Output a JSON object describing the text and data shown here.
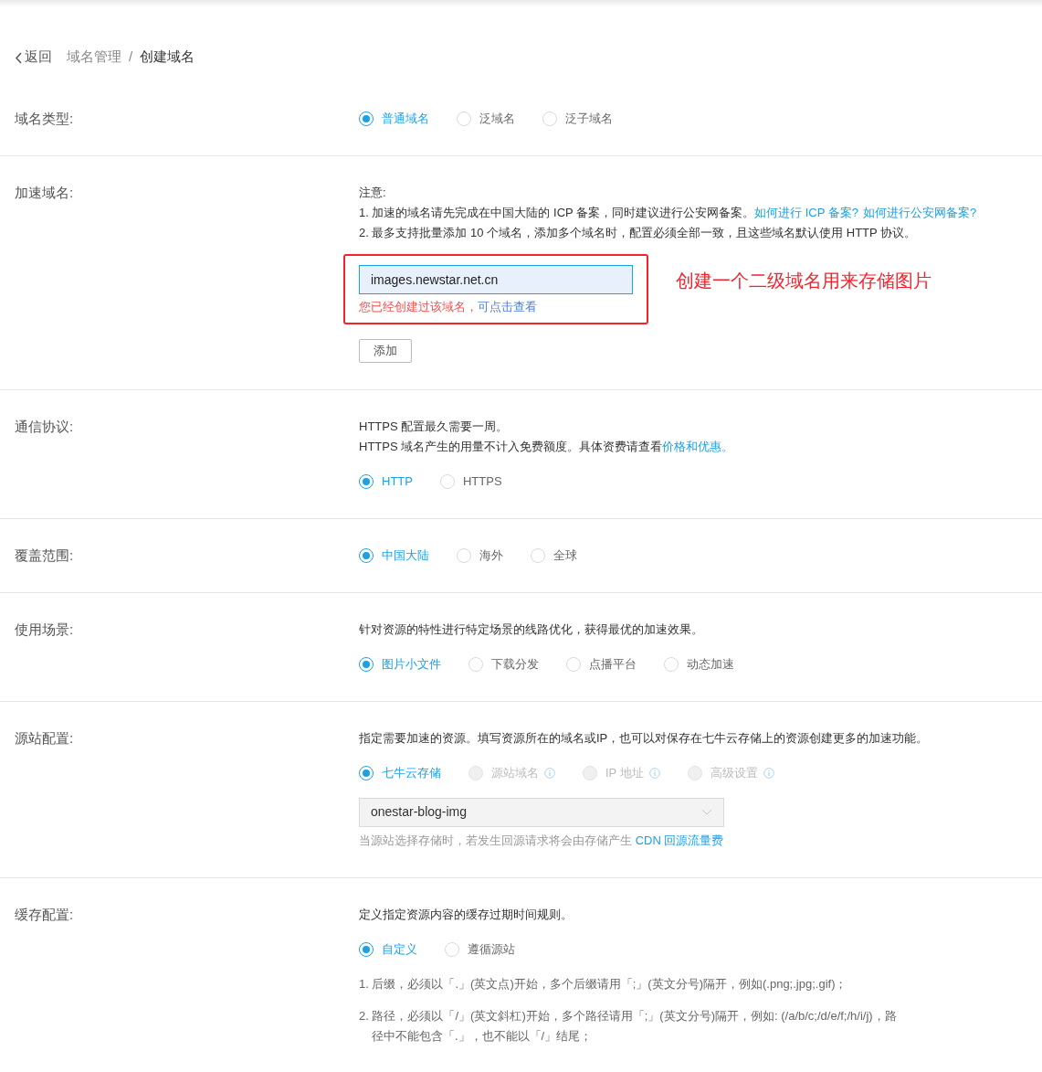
{
  "breadcrumb": {
    "back": "返回",
    "separator": "/",
    "items": [
      {
        "label": "域名管理",
        "current": false
      },
      {
        "label": "创建域名",
        "current": true
      }
    ]
  },
  "sections": [
    {
      "label": "域名类型:",
      "blocks": [
        {
          "kind": "radios",
          "options": [
            {
              "label": "普通域名",
              "selected": true
            },
            {
              "label": "泛域名",
              "selected": false
            },
            {
              "label": "泛子域名",
              "selected": false
            }
          ]
        }
      ]
    },
    {
      "label": "加速域名:",
      "blocks": [
        {
          "kind": "text",
          "lines": [
            [
              {
                "text": "注意:"
              }
            ],
            [
              {
                "text": "1. 加速的域名请先完成在中国大陆的 ICP 备案，同时建议进行公安网备案。"
              },
              {
                "text": "如何进行 ICP 备案?",
                "link": true
              },
              {
                "text": "如何进行公安网备案?",
                "link": true
              }
            ],
            [
              {
                "text": "2. 最多支持批量添加 10 个域名，添加多个域名时，配置必须全部一致，且这些域名默认使用 HTTP 协议。"
              }
            ]
          ]
        },
        {
          "kind": "domain_input",
          "value": "images.newstar.net.cn",
          "error": [
            {
              "text": "您已经创建过该域名，"
            },
            {
              "text": "可点击查看",
              "link": true
            }
          ],
          "annotation": "创建一个二级域名用来存储图片"
        },
        {
          "kind": "button",
          "label": "添加"
        }
      ]
    },
    {
      "label": "通信协议:",
      "blocks": [
        {
          "kind": "text",
          "lines": [
            [
              {
                "text": "HTTPS 配置最久需要一周。"
              }
            ],
            [
              {
                "text": "HTTPS 域名产生的用量不计入免费额度。具体资费请查看"
              },
              {
                "text": "价格和优惠。",
                "link": true
              }
            ]
          ]
        },
        {
          "kind": "radios",
          "options": [
            {
              "label": "HTTP",
              "selected": true
            },
            {
              "label": "HTTPS",
              "selected": false
            }
          ]
        }
      ]
    },
    {
      "label": "覆盖范围:",
      "blocks": [
        {
          "kind": "radios",
          "options": [
            {
              "label": "中国大陆",
              "selected": true
            },
            {
              "label": "海外",
              "selected": false
            },
            {
              "label": "全球",
              "selected": false
            }
          ]
        }
      ]
    },
    {
      "label": "使用场景:",
      "blocks": [
        {
          "kind": "text",
          "lines": [
            [
              {
                "text": "针对资源的特性进行特定场景的线路优化，获得最优的加速效果。"
              }
            ]
          ]
        },
        {
          "kind": "radios",
          "options": [
            {
              "label": "图片小文件",
              "selected": true
            },
            {
              "label": "下载分发",
              "selected": false
            },
            {
              "label": "点播平台",
              "selected": false
            },
            {
              "label": "动态加速",
              "selected": false
            }
          ]
        }
      ]
    },
    {
      "label": "源站配置:",
      "blocks": [
        {
          "kind": "text",
          "lines": [
            [
              {
                "text": "指定需要加速的资源。填写资源所在的域名或IP，也可以对保存在七牛云存储上的资源创建更多的加速功能。"
              }
            ]
          ]
        },
        {
          "kind": "radios",
          "options": [
            {
              "label": "七牛云存储",
              "selected": true,
              "disabled": false,
              "info": false
            },
            {
              "label": "源站域名",
              "selected": false,
              "disabled": true,
              "info": true
            },
            {
              "label": "IP 地址",
              "selected": false,
              "disabled": true,
              "info": true
            },
            {
              "label": "高级设置",
              "selected": false,
              "disabled": true,
              "info": true
            }
          ]
        },
        {
          "kind": "select",
          "value": "onestar-blog-img"
        },
        {
          "kind": "hint",
          "parts": [
            {
              "text": "当源站选择存储时，若发生回源请求将会由存储产生 "
            },
            {
              "text": "CDN 回源流量费",
              "link": true
            }
          ]
        }
      ]
    },
    {
      "label": "缓存配置:",
      "blocks": [
        {
          "kind": "text",
          "lines": [
            [
              {
                "text": "定义指定资源内容的缓存过期时间规则。"
              }
            ]
          ]
        },
        {
          "kind": "radios",
          "options": [
            {
              "label": "自定义",
              "selected": true
            },
            {
              "label": "遵循源站",
              "selected": false
            }
          ]
        },
        {
          "kind": "notes",
          "items": [
            "1. 后缀，必须以「.」(英文点)开始，多个后缀请用「;」(英文分号)隔开，例如(.png;.jpg;.gif)；",
            "2. 路径，必须以「/」(英文斜杠)开始，多个路径请用「;」(英文分号)隔开，例如: (/a/b/c;/d/e/f;/h/i/j)，路径中不能包含「.」，也不能以「/」结尾；"
          ]
        }
      ]
    }
  ]
}
